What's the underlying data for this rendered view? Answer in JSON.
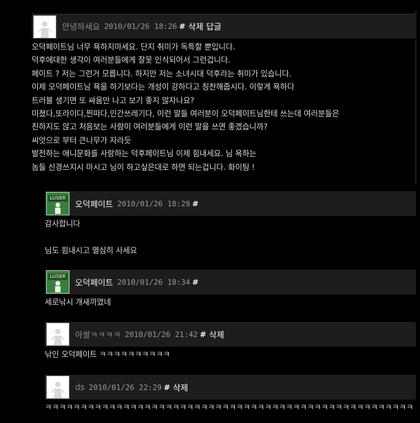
{
  "comments": [
    {
      "author": "안녕하세요",
      "date": "2010/01/26 18:26",
      "hash": "#",
      "actions": [
        "삭제",
        "답글"
      ],
      "lines": [
        "오덕페이트님 너무 욕하지마세요. 단지 취미가 독특할 뿐입니다.",
        "덕후에대한 생각이 여러분들에게 잘못 인식되어서 그런겁니다.",
        "페이트 ? 저는 그런거 모릅니다. 하지만 저는 소녀시대 덕후라는 취미가 있습니다.",
        "이제 오덕페이트님 욕을 하기보다는 개성이 강하다고 칭찬해줍시다. 이렇게 욕하다",
        "트러블 생기면 또 싸움만 나고 보기 좋지 않자나요?",
        "미쳤다,또라이다,찐따다,인간쓰레기다, 이런 말들 여러분이 오덕페이트님한테 쓰는데 여러분들은",
        "친하지도 않고 처음보는 사람이 여러분들에게 이런 말을 쓰면 좋겠습니까?",
        "씨앗으로 부터 큰나무가 자라듯",
        "발전하는 애니문화를 사랑하는 덕후페이트님 이제 힘내세요. 님 욕하는",
        "놈들 신경쓰지시 마시고 님이 하고싶은대로 하면 되는겁니다. 화이팅 !"
      ]
    },
    {
      "author": "오덕페이트",
      "avatar_tag": "LUSER",
      "date": "2010/01/26 18:29",
      "hash": "#",
      "lines": [
        "감사합니다",
        "",
        "님도 힘내시고 열심히 사세요"
      ]
    },
    {
      "author": "오덕페이트",
      "avatar_tag": "LUSER",
      "date": "2010/01/26 18:34",
      "hash": "#",
      "lines": [
        "세로낚시 개새끼였네"
      ]
    },
    {
      "author": "아쌀ㅋㅋㅋㅋ",
      "date": "2010/01/26 21:42",
      "hash": "#",
      "actions": [
        "삭제"
      ],
      "lines": [
        "낚인 오덕페이트 ㅋㅋㅋㅋㅋㅋㅋㅋㅋㅋ"
      ]
    },
    {
      "author": "ds",
      "date": "2010/01/26 22:29",
      "hash": "#",
      "actions": [
        "삭제"
      ],
      "lines": [
        "ㅋㅋㅋㅋㅋㅋㅋㅋㅋㅋㅋㅋㅋㅋㅋㅋㅋㅋㅋㅋㅋㅋㅋㅋㅋㅋㅋㅋㅋㅋㅋㅋㅋㅋㅋㅋㅋㅋㅋㅋㅋㅋㅋㅋㅋㅋㅋㅋㅋㅋㅋㅋ"
      ]
    }
  ],
  "colors": {
    "background": "#000000",
    "header_bg": "#1d1d1d",
    "luser_avatar": "#3b7d3f"
  },
  "icons": {
    "guest_avatar": "silhouette-icon",
    "member_avatar": "luser-badge-icon"
  }
}
